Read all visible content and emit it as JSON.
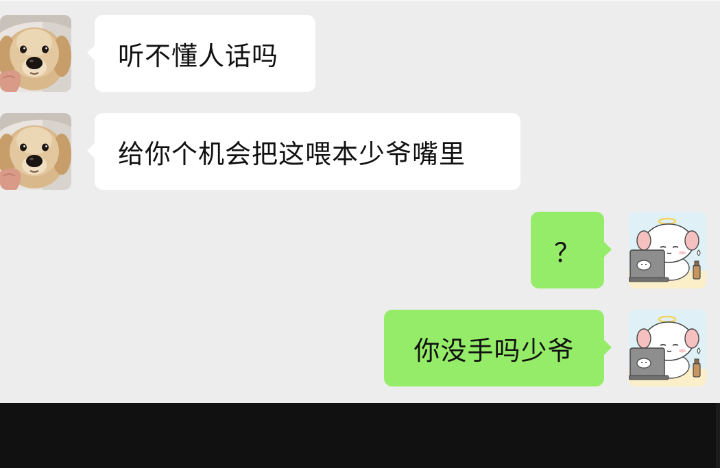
{
  "messages": [
    {
      "side": "left",
      "avatar": "golden-retriever-puppy-avatar",
      "text": "听不懂人话吗"
    },
    {
      "side": "left",
      "avatar": "golden-retriever-puppy-avatar",
      "text": "给你个机会把这喂本少爷嘴里"
    },
    {
      "side": "right",
      "avatar": "cartoon-puppy-at-laptop-avatar",
      "text": "？"
    },
    {
      "side": "right",
      "avatar": "cartoon-puppy-at-laptop-avatar",
      "text": "你没手吗少爷"
    }
  ],
  "colors": {
    "chat_background": "#ededed",
    "incoming_bubble": "#ffffff",
    "outgoing_bubble": "#95ec69",
    "bottom_bar": "#111111"
  }
}
